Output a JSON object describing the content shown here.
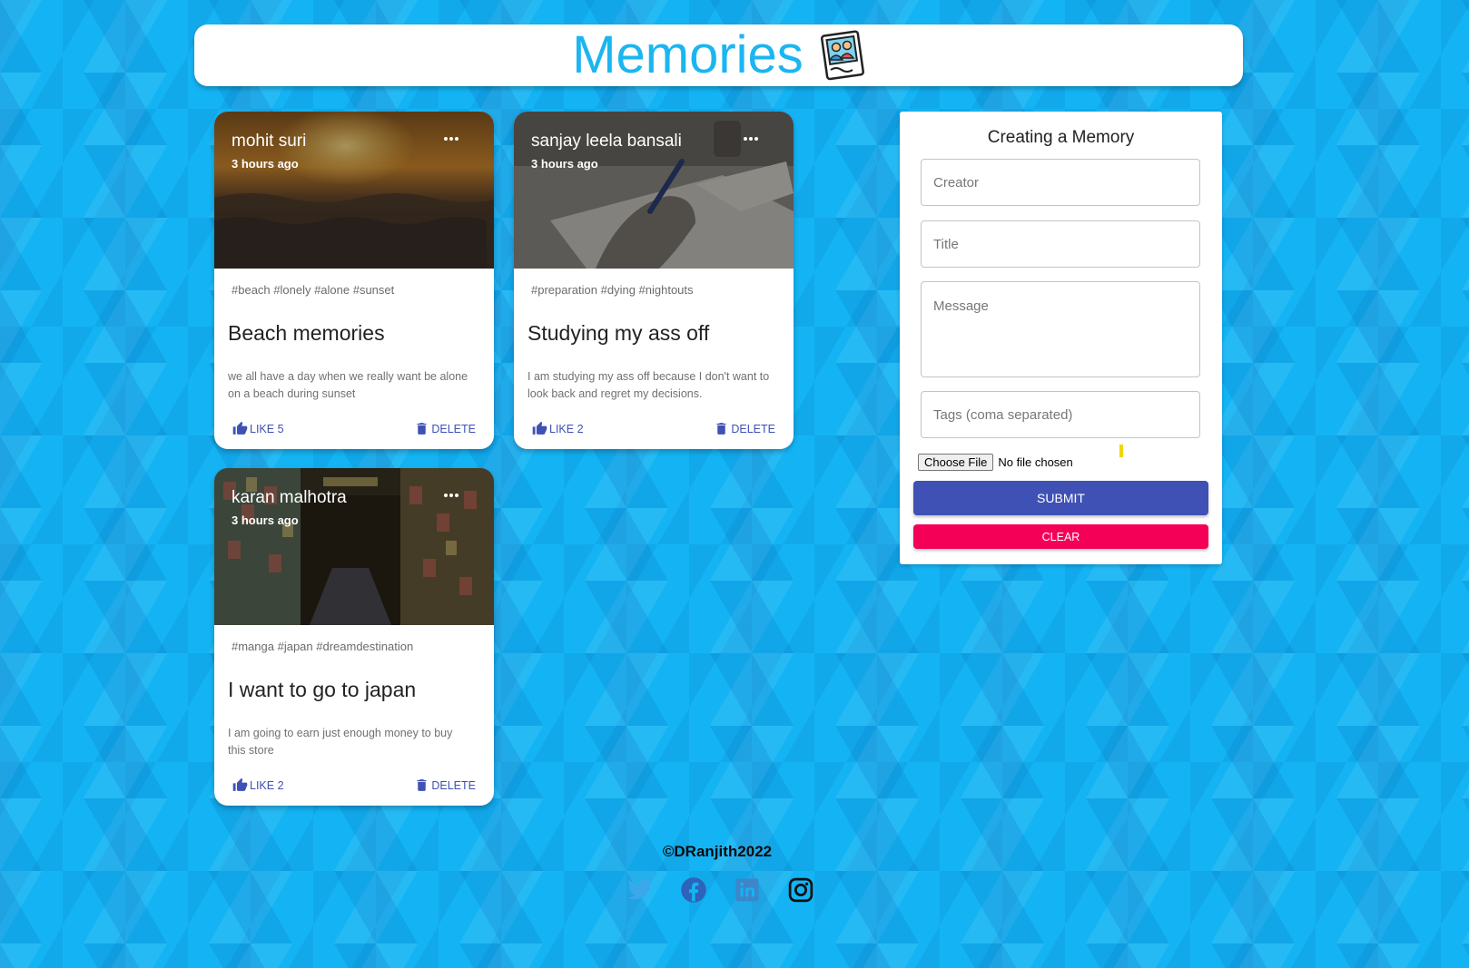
{
  "app": {
    "title": "Memories",
    "logo_icon": "photo-frame-icon"
  },
  "posts": [
    {
      "creator": "mohit suri",
      "time": "3 hours ago",
      "tags": "#beach #lonely #alone #sunset",
      "title": "Beach memories",
      "message": "we all have a day when we really want be alone on a beach during sunset",
      "like_label": "LIKE 5",
      "delete_label": "DELETE",
      "image": "sunset-beach"
    },
    {
      "creator": "sanjay leela bansali",
      "time": "3 hours ago",
      "tags": "#preparation #dying #nightouts",
      "title": "Studying my ass off",
      "message": "I am studying my ass off because I don't want to look back and regret my decisions.",
      "like_label": "LIKE 2",
      "delete_label": "DELETE",
      "image": "writing-desk"
    },
    {
      "creator": "karan malhotra",
      "time": "3 hours ago",
      "tags": "#manga #japan #dreamdestination",
      "title": "I want to go to japan",
      "message": "I am going to earn just enough money to buy this store",
      "like_label": "LIKE 2",
      "delete_label": "DELETE",
      "image": "manga-store"
    }
  ],
  "form": {
    "title": "Creating a Memory",
    "creator_placeholder": "Creator",
    "title_placeholder": "Title",
    "message_placeholder": "Message",
    "tags_placeholder": "Tags (coma separated)",
    "file_button": "Choose File",
    "file_status": "No file chosen",
    "submit_label": "SUBMIT",
    "clear_label": "CLEAR"
  },
  "footer": {
    "copyright": "©DRanjith2022",
    "socials": [
      "twitter-icon",
      "facebook-icon",
      "linkedin-icon",
      "instagram-icon"
    ]
  },
  "colors": {
    "background": "#14b4f4",
    "title_blue": "#1bb6f0",
    "primary": "#3f51b5",
    "secondary": "#f50057"
  }
}
